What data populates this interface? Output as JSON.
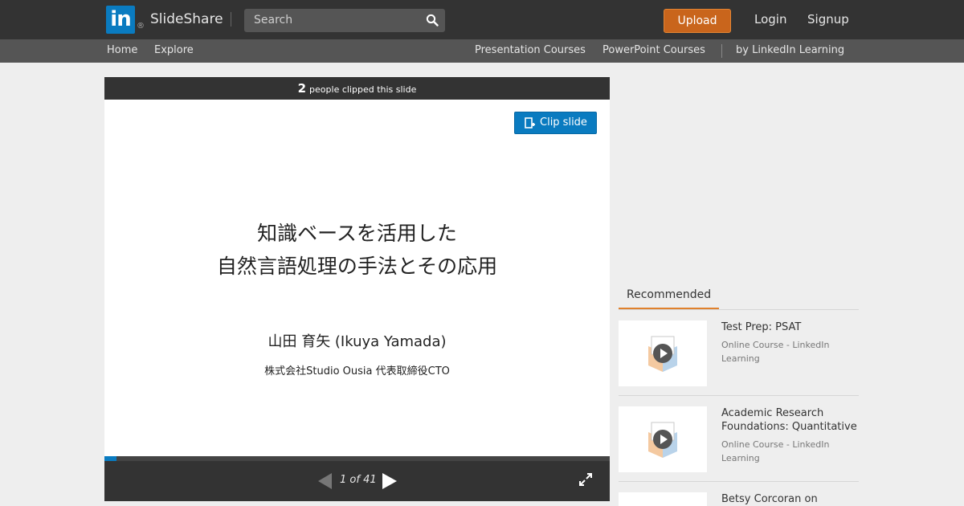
{
  "header": {
    "logo_text": "in",
    "logo_reg": "®",
    "brand": "SlideShare",
    "search_placeholder": "Search",
    "upload_label": "Upload",
    "login_label": "Login",
    "signup_label": "Signup"
  },
  "subnav": {
    "home": "Home",
    "explore": "Explore",
    "presentation_courses": "Presentation Courses",
    "powerpoint_courses": "PowerPoint Courses",
    "by_linkedin": "by LinkedIn Learning"
  },
  "player": {
    "clip_count": "2",
    "clip_text": "people clipped this slide",
    "clip_button": "Clip slide",
    "slide_title_line1": "知識ベースを活用した",
    "slide_title_line2": "自然言語処理の手法とその応用",
    "slide_author": "山田 育矢 (Ikuya Yamada)",
    "slide_company": "株式会社Studio Ousia 代表取締役CTO",
    "page_indicator": "1 of 41",
    "progress_fraction": 0.024
  },
  "sidebar": {
    "tab_label": "Recommended",
    "items": [
      {
        "title": "Test Prep: PSAT",
        "subtitle": "Online Course - LinkedIn Learning"
      },
      {
        "title": "Academic Research Foundations: Quantitative",
        "subtitle": "Online Course - LinkedIn Learning"
      },
      {
        "title": "Betsy Corcoran on",
        "subtitle": ""
      }
    ]
  },
  "colors": {
    "topbar": "#333333",
    "subnav": "#555555",
    "linkedin_blue": "#0a7bc0",
    "upload_orange": "#c9651c",
    "tab_underline": "#e0812d"
  },
  "icons": [
    "search-icon",
    "clip-icon",
    "prev-arrow-icon",
    "next-arrow-icon",
    "fullscreen-icon",
    "play-icon"
  ]
}
